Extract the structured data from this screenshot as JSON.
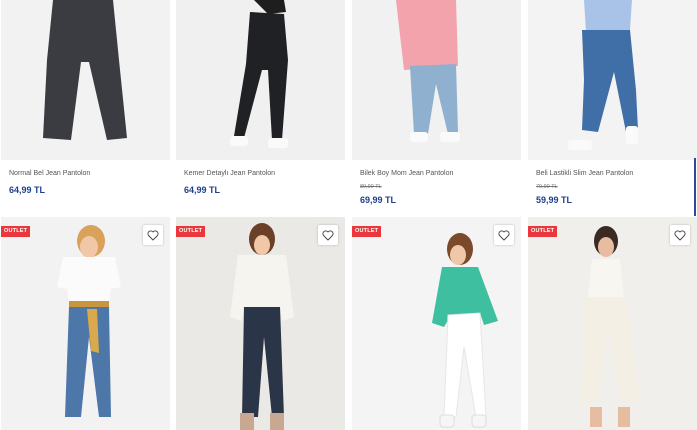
{
  "colors": {
    "price": "#1f3f8f",
    "badge": "#e8383d"
  },
  "row1": [
    {
      "name": "Normal Bel Jean Pantolon",
      "old_price": "",
      "price": "64,99 TL"
    },
    {
      "name": "Kemer Detaylı Jean Pantolon",
      "old_price": "",
      "price": "64,99 TL"
    },
    {
      "name": "Bilek Boy Mom Jean Pantolon",
      "old_price": "89,99 TL",
      "price": "69,99 TL"
    },
    {
      "name": "Beli Lastikli Slim Jean Pantolon",
      "old_price": "79,99 TL",
      "price": "59,99 TL"
    }
  ],
  "row2": [
    {
      "badge": "OUTLET",
      "icon": "heart-icon"
    },
    {
      "badge": "OUTLET",
      "icon": "heart-icon"
    },
    {
      "badge": "OUTLET",
      "icon": "heart-icon"
    },
    {
      "badge": "OUTLET",
      "icon": "heart-icon"
    }
  ]
}
